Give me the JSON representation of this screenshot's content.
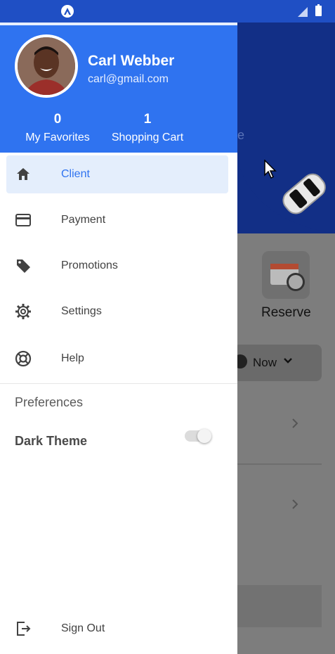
{
  "status_bar": {
    "left_icon": "app-notification-icon",
    "right_icons": [
      "signal-icon",
      "battery-icon"
    ]
  },
  "drawer": {
    "user": {
      "name": "Carl Webber",
      "email": "carl@gmail.com",
      "avatar": "avatar"
    },
    "stats": {
      "favorites_count": "0",
      "favorites_label": "My Favorites",
      "cart_count": "1",
      "cart_label": "Shopping Cart"
    },
    "menu": [
      {
        "label": "Client",
        "icon": "home-icon",
        "active": true
      },
      {
        "label": "Payment",
        "icon": "credit-card-icon",
        "active": false
      },
      {
        "label": "Promotions",
        "icon": "tag-icon",
        "active": false
      },
      {
        "label": "Settings",
        "icon": "gear-icon",
        "active": false
      },
      {
        "label": "Help",
        "icon": "lifebuoy-icon",
        "active": false
      }
    ],
    "preferences": {
      "title": "Preferences",
      "dark_theme_label": "Dark Theme",
      "dark_theme_enabled": false
    },
    "sign_out": {
      "label": "Sign Out",
      "icon": "sign-out-icon"
    }
  },
  "background_app": {
    "reserve_label": "Reserve",
    "now_label": "Now",
    "faint_letter": "e"
  },
  "colors": {
    "accent": "#2f73f0",
    "header_bg": "#2f73f0",
    "active_item_bg": "#e4eefc",
    "status_bar": "#1f4fc4"
  }
}
